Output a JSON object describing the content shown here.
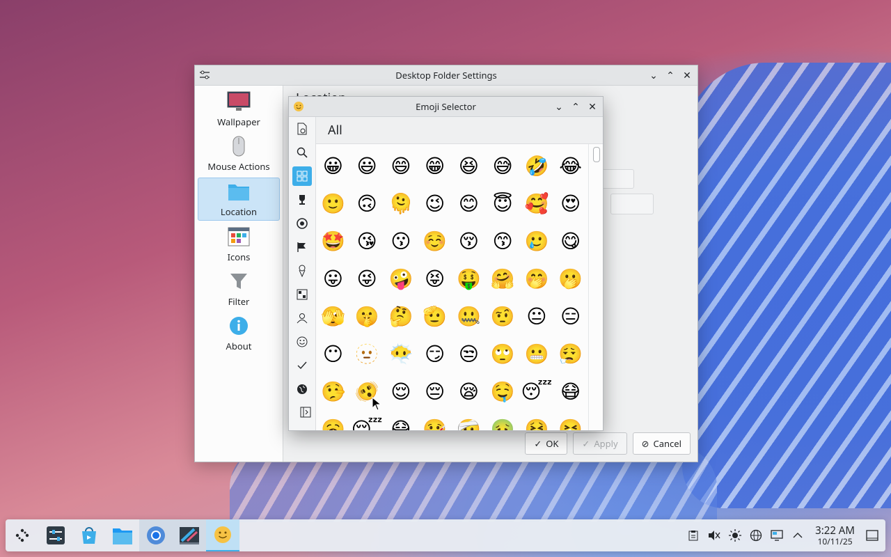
{
  "main_window": {
    "title": "Desktop Folder Settings",
    "heading": "Location",
    "sidebar": [
      {
        "label": "Wallpaper",
        "icon": "monitor-icon"
      },
      {
        "label": "Mouse Actions",
        "icon": "mouse-icon"
      },
      {
        "label": "Location",
        "icon": "folder-icon",
        "active": true
      },
      {
        "label": "Icons",
        "icon": "icons-grid-icon"
      },
      {
        "label": "Filter",
        "icon": "filter-icon"
      },
      {
        "label": "About",
        "icon": "info-icon"
      }
    ],
    "buttons": {
      "ok": "OK",
      "apply": "Apply",
      "cancel": "Cancel"
    }
  },
  "emoji_window": {
    "title": "Emoji Selector",
    "category_title": "All",
    "categories": [
      "recent-icon",
      "search-icon",
      "all-icon",
      "trophy-icon",
      "activities-icon",
      "flag-icon",
      "food-icon",
      "objects-icon",
      "people-icon",
      "smileys-icon",
      "symbols-icon",
      "travel-icon"
    ],
    "emojis": [
      "😀",
      "😃",
      "😄",
      "😁",
      "😆",
      "😅",
      "🤣",
      "😂",
      "🙂",
      "🙃",
      "🫠",
      "😉",
      "😊",
      "😇",
      "🥰",
      "😍",
      "🤩",
      "😘",
      "😗",
      "☺️",
      "😚",
      "😙",
      "🥲",
      "😋",
      "😛",
      "😜",
      "🤪",
      "😝",
      "🤑",
      "🤗",
      "🤭",
      "🫢",
      "🫣",
      "🤫",
      "🤔",
      "🫡",
      "🤐",
      "🤨",
      "😐",
      "😑",
      "😶",
      "🫥",
      "😶‍🌫️",
      "😏",
      "😒",
      "🙄",
      "😬",
      "😮‍💨",
      "🤥",
      "🫨",
      "😌",
      "😔",
      "😪",
      "🤤",
      "😴",
      "😷",
      "🥱",
      "😴",
      "😷",
      "🤒",
      "🤕",
      "🤢",
      "🤮",
      "🤧"
    ]
  },
  "taskbar": {
    "apps": [
      "app-launcher-icon",
      "system-settings-icon",
      "discover-store-icon",
      "file-manager-icon",
      "chromium-icon",
      "kate-editor-icon",
      "emoji-selector-icon"
    ],
    "time": "3:22 AM",
    "date": "10/11/25"
  }
}
